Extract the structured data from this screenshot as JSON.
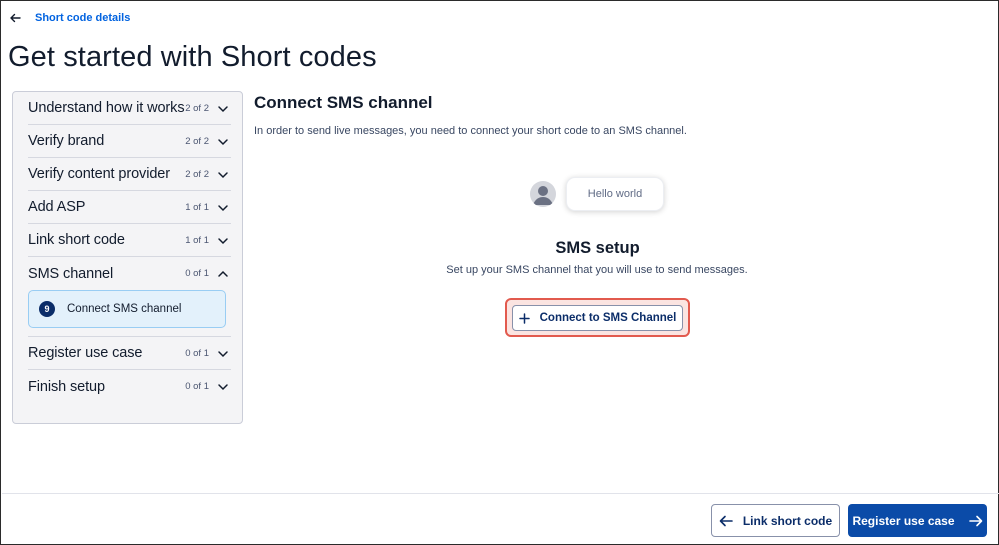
{
  "header": {
    "back_label": "Short code details",
    "title": "Get started with Short codes"
  },
  "sidebar": {
    "steps": [
      {
        "label": "Understand how it works",
        "count": "2 of 2",
        "chevron": "chevron-down-icon"
      },
      {
        "label": "Verify brand",
        "count": "2 of 2",
        "chevron": "chevron-down-icon"
      },
      {
        "label": "Verify content provider",
        "count": "2 of 2",
        "chevron": "chevron-down-icon"
      },
      {
        "label": "Add ASP",
        "count": "1 of 1",
        "chevron": "chevron-down-icon"
      },
      {
        "label": "Link short code",
        "count": "1 of 1",
        "chevron": "chevron-down-icon"
      },
      {
        "label": "SMS channel",
        "count": "0 of 1",
        "chevron": "chevron-up-icon",
        "substep": {
          "number": "9",
          "label": "Connect SMS channel"
        }
      },
      {
        "label": "Register use case",
        "count": "0 of 1",
        "chevron": "chevron-down-icon"
      },
      {
        "label": "Finish setup",
        "count": "0 of 1",
        "chevron": "chevron-down-icon"
      }
    ]
  },
  "main": {
    "title": "Connect SMS channel",
    "description": "In order to send live messages, you need to connect your short code to an SMS channel.",
    "preview_bubble": "Hello world",
    "setup_title": "SMS setup",
    "setup_description": "Set up your SMS channel that you will use to send messages.",
    "connect_button": "Connect to SMS Channel"
  },
  "footer": {
    "back_button": "Link short code",
    "next_button": "Register use case"
  },
  "colors": {
    "accent": "#0263e0",
    "primary_button": "#0b4ba8",
    "highlight": "#e25a4e"
  }
}
